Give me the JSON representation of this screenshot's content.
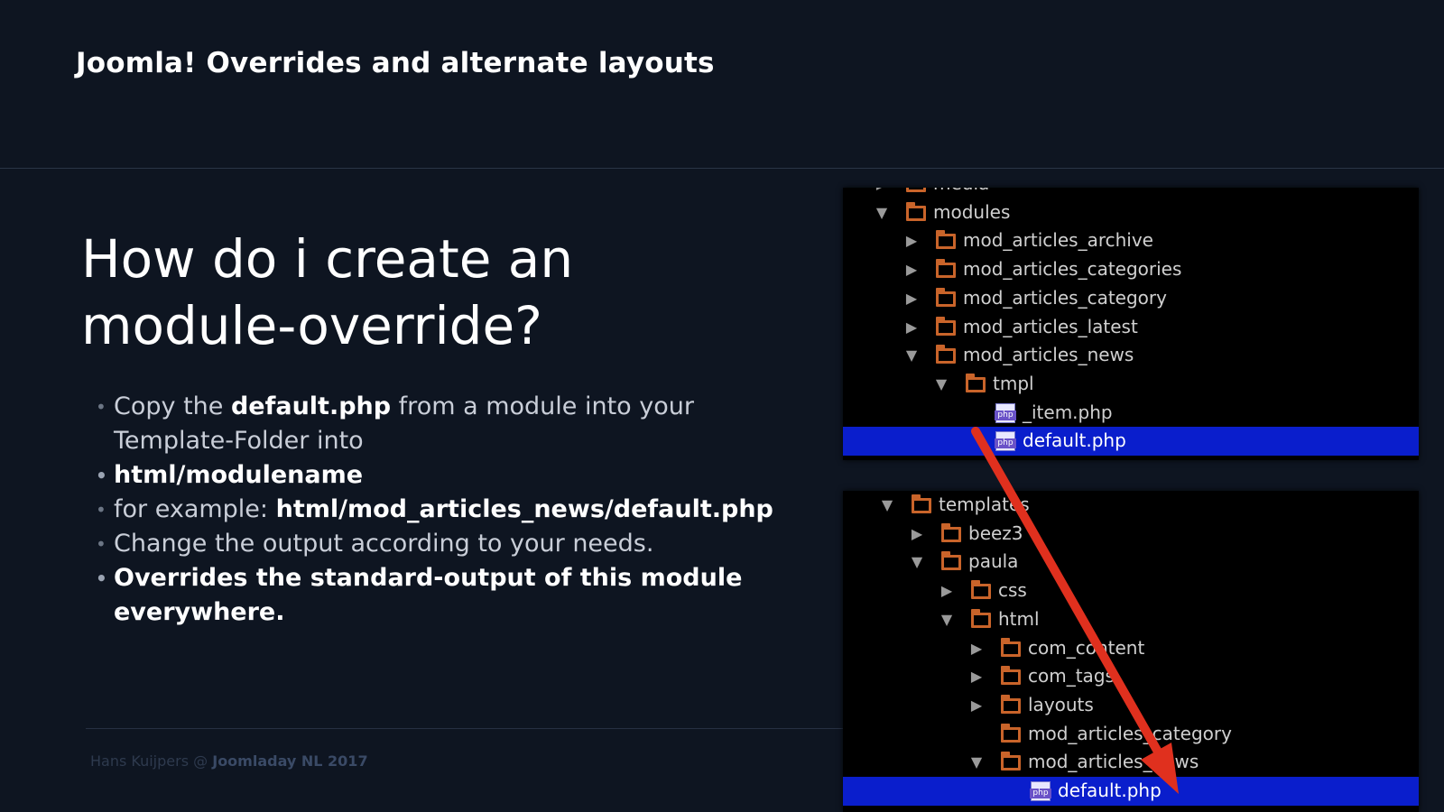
{
  "header": {
    "title": "Joomla! Overrides and alternate layouts"
  },
  "slide": {
    "title": "How do i create an module-override?",
    "bullets": [
      {
        "pre": "Copy the ",
        "bold": "default.php",
        "post": " from a module into your Template-Folder into"
      },
      {
        "text": "html/modulename"
      },
      {
        "pre": "for example: ",
        "bold": "html/mod_articles_news/default.php",
        "post": ""
      },
      {
        "text": "Change the output according to your needs."
      },
      {
        "text": "Overrides the standard-output of this module everywhere."
      }
    ]
  },
  "footer": {
    "author": "Hans Kuijpers",
    "at": "@",
    "event": "Joomladay NL 2017"
  },
  "tree_top": [
    {
      "label": "media",
      "type": "folder",
      "expander": "collapsed",
      "depth": 0
    },
    {
      "label": "modules",
      "type": "folder",
      "expander": "expanded",
      "depth": 0
    },
    {
      "label": "mod_articles_archive",
      "type": "folder",
      "expander": "collapsed",
      "depth": 1
    },
    {
      "label": "mod_articles_categories",
      "type": "folder",
      "expander": "collapsed",
      "depth": 1
    },
    {
      "label": "mod_articles_category",
      "type": "folder",
      "expander": "collapsed",
      "depth": 1
    },
    {
      "label": "mod_articles_latest",
      "type": "folder",
      "expander": "collapsed",
      "depth": 1
    },
    {
      "label": "mod_articles_news",
      "type": "folder",
      "expander": "expanded",
      "depth": 1
    },
    {
      "label": "tmpl",
      "type": "folder",
      "expander": "expanded",
      "depth": 2
    },
    {
      "label": "_item.php",
      "type": "file",
      "expander": "none",
      "depth": 3
    },
    {
      "label": "default.php",
      "type": "file",
      "expander": "none",
      "depth": 3,
      "selected": true
    }
  ],
  "tree_bottom": [
    {
      "label": "templates",
      "type": "folder",
      "expander": "expanded",
      "depth": 0
    },
    {
      "label": "beez3",
      "type": "folder",
      "expander": "collapsed",
      "depth": 1
    },
    {
      "label": "paula",
      "type": "folder",
      "expander": "expanded",
      "depth": 1
    },
    {
      "label": "css",
      "type": "folder",
      "expander": "collapsed",
      "depth": 2
    },
    {
      "label": "html",
      "type": "folder",
      "expander": "expanded",
      "depth": 2
    },
    {
      "label": "com_content",
      "type": "folder",
      "expander": "collapsed",
      "depth": 3
    },
    {
      "label": "com_tags",
      "type": "folder",
      "expander": "collapsed",
      "depth": 3
    },
    {
      "label": "layouts",
      "type": "folder",
      "expander": "collapsed",
      "depth": 3
    },
    {
      "label": "mod_articles_category",
      "type": "folder",
      "expander": "none",
      "depth": 3
    },
    {
      "label": "mod_articles_news",
      "type": "folder",
      "expander": "expanded",
      "depth": 3
    },
    {
      "label": "default.php",
      "type": "file",
      "expander": "none",
      "depth": 4,
      "selected": true
    }
  ],
  "file_badge": "php",
  "colors": {
    "background": "#0e1521",
    "folder": "#c9642a",
    "selection": "#0a1ecc",
    "arrow": "#e0301e"
  }
}
